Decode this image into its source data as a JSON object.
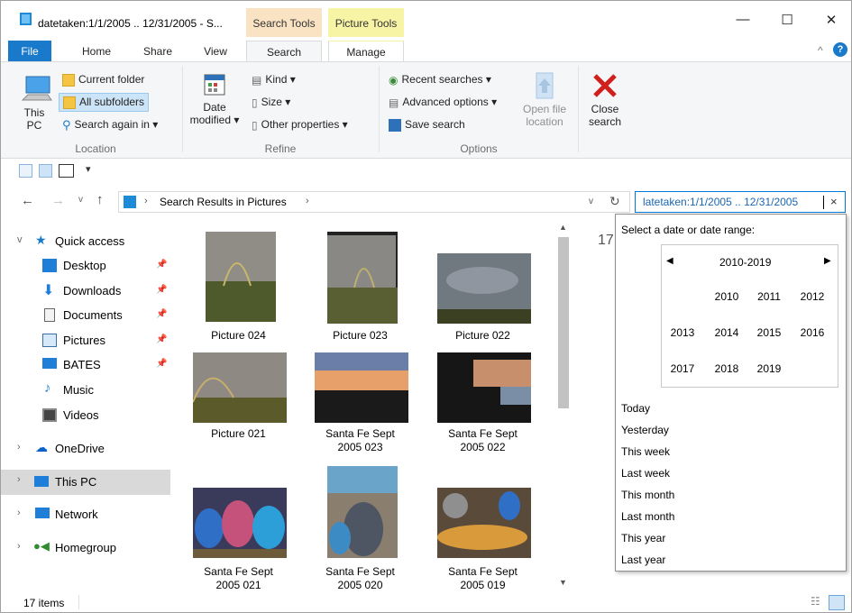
{
  "window": {
    "title": "datetaken:1/1/2005 .. 12/31/2005 - S...",
    "context_tabs": [
      "Search Tools",
      "Picture Tools"
    ],
    "controls": {
      "minimize": "—",
      "maximize": "☐",
      "close": "✕"
    }
  },
  "ribbon": {
    "tabs": {
      "file": "File",
      "home": "Home",
      "share": "Share",
      "view": "View",
      "search": "Search",
      "manage": "Manage"
    },
    "location": {
      "this_pc": "This PC",
      "current_folder": "Current folder",
      "all_subfolders": "All subfolders",
      "search_again_in": "Search again in ▾",
      "group_label": "Location"
    },
    "refine": {
      "date_modified": "Date",
      "date_modified_2": "modified ▾",
      "kind": "Kind ▾",
      "size": "Size ▾",
      "other_properties": "Other properties ▾",
      "group_label": "Refine"
    },
    "options": {
      "recent_searches": "Recent searches ▾",
      "advanced_options": "Advanced options ▾",
      "save_search": "Save search",
      "open_file_location_1": "Open file",
      "open_file_location_2": "location",
      "group_label": "Options"
    },
    "close_search_1": "Close",
    "close_search_2": "search"
  },
  "address": {
    "breadcrumb": "Search Results in Pictures",
    "search_value": "latetaken:1/1/2005 .. 12/31/2005"
  },
  "nav": {
    "quick_access": "Quick access",
    "items": [
      "Desktop",
      "Downloads",
      "Documents",
      "Pictures",
      "BATES",
      "Music",
      "Videos"
    ],
    "onedrive": "OneDrive",
    "this_pc": "This PC",
    "network": "Network",
    "homegroup": "Homegroup"
  },
  "files": [
    {
      "line1": "Picture 024",
      "line2": ""
    },
    {
      "line1": "Picture 023",
      "line2": ""
    },
    {
      "line1": "Picture 022",
      "line2": ""
    },
    {
      "line1": "Picture 021",
      "line2": ""
    },
    {
      "line1": "Santa Fe Sept",
      "line2": "2005 023"
    },
    {
      "line1": "Santa Fe Sept",
      "line2": "2005 022"
    },
    {
      "line1": "Santa Fe Sept",
      "line2": "2005 021"
    },
    {
      "line1": "Santa Fe Sept",
      "line2": "2005 020"
    },
    {
      "line1": "Santa Fe Sept",
      "line2": "2005 019"
    }
  ],
  "count_peek": "17",
  "date_picker": {
    "title": "Select a date or date range:",
    "decade": "2010-2019",
    "years": [
      "2010",
      "2011",
      "2012",
      "2013",
      "2014",
      "2015",
      "2016",
      "2017",
      "2018",
      "2019"
    ],
    "presets": [
      "Today",
      "Yesterday",
      "This week",
      "Last week",
      "This month",
      "Last month",
      "This year",
      "Last year"
    ]
  },
  "status": {
    "items": "17 items"
  },
  "colors": {
    "accent": "#1979ca",
    "search_tools": "#f9e3c3",
    "picture_tools": "#f7f4a6",
    "link": "#0066cc"
  }
}
